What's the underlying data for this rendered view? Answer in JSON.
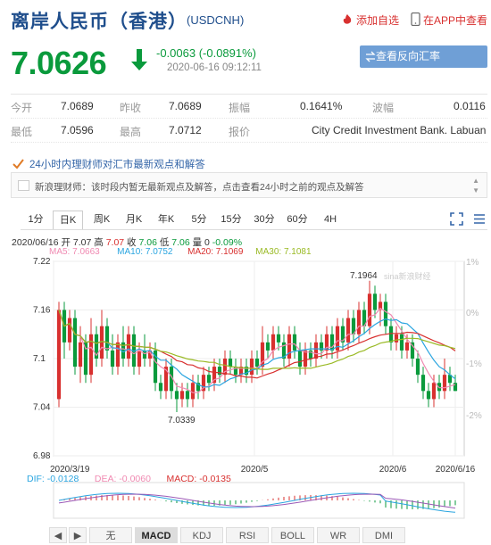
{
  "header": {
    "title": "离岸人民币（香港）",
    "code": "(USDCNH)",
    "add_watch": "添加自选",
    "view_app": "在APP中查看"
  },
  "quote": {
    "price": "7.0626",
    "change": "-0.0063 (-0.0891%)",
    "time": "2020-06-16 09:12:11",
    "reverse_button": "查看反向汇率 CNHUSD",
    "color_down": "#0a9a3c"
  },
  "stats": {
    "open_label": "今开",
    "open": "7.0689",
    "prev_label": "昨收",
    "prev": "7.0689",
    "amp_label": "振幅",
    "amp": "0.1641%",
    "wave_label": "波幅",
    "wave": "0.0116",
    "low_label": "最低",
    "low": "7.0596",
    "high_label": "最高",
    "high": "7.0712",
    "quote_label": "报价",
    "quote_src": "City Credit Investment Bank. Labuan"
  },
  "news": {
    "title": "24小时内理财师对汇市最新观点和解答",
    "text": "新浪理财师：该时段内暂无最新观点及解答，点击查看24小时之前的观点及解答"
  },
  "tabs": [
    "1分",
    "日K",
    "周K",
    "月K",
    "年K",
    "5分",
    "15分",
    "30分",
    "60分",
    "4H"
  ],
  "active_tab": "日K",
  "info": {
    "line1_date": "2020/06/16",
    "line1_open_label": "开",
    "line1_open": "7.07",
    "line1_high_label": "高",
    "line1_high": "7.07",
    "line1_close_label": "收",
    "line1_close": "7.06",
    "line1_low_label": "低",
    "line1_low": "7.06",
    "line1_vol_label": "量",
    "line1_vol": "0",
    "line1_chg": "-0.09%",
    "ma5": "MA5: 7.0663",
    "ma10": "MA10: 7.0752",
    "ma20": "MA20: 7.1069",
    "ma30": "MA30: 7.1081"
  },
  "colors": {
    "up": "#d8302f",
    "down": "#0a9a3c",
    "ma5": "#f08ab2",
    "ma10": "#2aa5e0",
    "ma20": "#d8302f",
    "ma30": "#9aba25"
  },
  "chart_data": {
    "type": "candlestick",
    "y_ticks": [
      "7.22",
      "7.16",
      "7.1",
      "7.04",
      "6.98"
    ],
    "pct_ticks": [
      "1%",
      "0%",
      "-1%",
      "-2%"
    ],
    "x_ticks": [
      "2020/3/19",
      "2020/5",
      "2020/6",
      "2020/6/16"
    ],
    "high_label": "7.1964",
    "low_label": "7.0339",
    "watermark": "sina新浪财经",
    "ylim": [
      6.98,
      7.22
    ],
    "candles": [
      [
        7.05,
        7.16,
        7.17,
        7.04
      ],
      [
        7.16,
        7.12,
        7.17,
        7.1
      ],
      [
        7.12,
        7.15,
        7.16,
        7.11
      ],
      [
        7.15,
        7.09,
        7.16,
        7.08
      ],
      [
        7.09,
        7.12,
        7.14,
        7.07
      ],
      [
        7.12,
        7.08,
        7.13,
        7.07
      ],
      [
        7.08,
        7.13,
        7.15,
        7.07
      ],
      [
        7.13,
        7.1,
        7.14,
        7.09
      ],
      [
        7.1,
        7.14,
        7.16,
        7.09
      ],
      [
        7.14,
        7.11,
        7.15,
        7.1
      ],
      [
        7.11,
        7.09,
        7.13,
        7.08
      ],
      [
        7.09,
        7.12,
        7.13,
        7.08
      ],
      [
        7.12,
        7.1,
        7.14,
        7.09
      ],
      [
        7.1,
        7.13,
        7.14,
        7.09
      ],
      [
        7.13,
        7.09,
        7.14,
        7.08
      ],
      [
        7.09,
        7.11,
        7.12,
        7.08
      ],
      [
        7.11,
        7.1,
        7.13,
        7.09
      ],
      [
        7.1,
        7.11,
        7.12,
        7.09
      ],
      [
        7.11,
        7.07,
        7.12,
        7.06
      ],
      [
        7.07,
        7.06,
        7.08,
        7.05
      ],
      [
        7.06,
        7.09,
        7.1,
        7.05
      ],
      [
        7.09,
        7.06,
        7.1,
        7.05
      ],
      [
        7.06,
        7.05,
        7.07,
        7.034
      ],
      [
        7.05,
        7.06,
        7.07,
        7.04
      ],
      [
        7.06,
        7.05,
        7.07,
        7.04
      ],
      [
        7.05,
        7.07,
        7.08,
        7.04
      ],
      [
        7.07,
        7.06,
        7.08,
        7.05
      ],
      [
        7.06,
        7.08,
        7.09,
        7.05
      ],
      [
        7.08,
        7.07,
        7.09,
        7.06
      ],
      [
        7.07,
        7.09,
        7.1,
        7.06
      ],
      [
        7.09,
        7.08,
        7.1,
        7.07
      ],
      [
        7.08,
        7.1,
        7.11,
        7.07
      ],
      [
        7.1,
        7.09,
        7.11,
        7.08
      ],
      [
        7.09,
        7.08,
        7.1,
        7.07
      ],
      [
        7.08,
        7.09,
        7.1,
        7.07
      ],
      [
        7.09,
        7.08,
        7.1,
        7.07
      ],
      [
        7.08,
        7.1,
        7.11,
        7.07
      ],
      [
        7.1,
        7.09,
        7.11,
        7.08
      ],
      [
        7.09,
        7.12,
        7.14,
        7.08
      ],
      [
        7.12,
        7.11,
        7.13,
        7.1
      ],
      [
        7.11,
        7.13,
        7.14,
        7.1
      ],
      [
        7.13,
        7.12,
        7.14,
        7.11
      ],
      [
        7.12,
        7.1,
        7.13,
        7.09
      ],
      [
        7.1,
        7.13,
        7.14,
        7.09
      ],
      [
        7.13,
        7.11,
        7.14,
        7.1
      ],
      [
        7.11,
        7.09,
        7.12,
        7.08
      ],
      [
        7.09,
        7.11,
        7.12,
        7.08
      ],
      [
        7.11,
        7.1,
        7.12,
        7.09
      ],
      [
        7.1,
        7.12,
        7.13,
        7.09
      ],
      [
        7.12,
        7.11,
        7.13,
        7.1
      ],
      [
        7.11,
        7.13,
        7.14,
        7.1
      ],
      [
        7.13,
        7.11,
        7.14,
        7.1
      ],
      [
        7.11,
        7.14,
        7.15,
        7.1
      ],
      [
        7.14,
        7.12,
        7.15,
        7.11
      ],
      [
        7.12,
        7.15,
        7.16,
        7.11
      ],
      [
        7.15,
        7.13,
        7.16,
        7.12
      ],
      [
        7.13,
        7.16,
        7.17,
        7.12
      ],
      [
        7.16,
        7.14,
        7.17,
        7.13
      ],
      [
        7.14,
        7.18,
        7.196,
        7.13
      ],
      [
        7.18,
        7.16,
        7.19,
        7.15
      ],
      [
        7.16,
        7.17,
        7.18,
        7.14
      ],
      [
        7.17,
        7.14,
        7.18,
        7.13
      ],
      [
        7.14,
        7.12,
        7.15,
        7.11
      ],
      [
        7.12,
        7.13,
        7.14,
        7.11
      ],
      [
        7.13,
        7.11,
        7.14,
        7.1
      ],
      [
        7.11,
        7.12,
        7.13,
        7.1
      ],
      [
        7.12,
        7.1,
        7.13,
        7.09
      ],
      [
        7.1,
        7.08,
        7.11,
        7.07
      ],
      [
        7.08,
        7.06,
        7.09,
        7.05
      ],
      [
        7.06,
        7.05,
        7.07,
        7.04
      ],
      [
        7.05,
        7.07,
        7.08,
        7.04
      ],
      [
        7.07,
        7.06,
        7.08,
        7.05
      ],
      [
        7.06,
        7.08,
        7.1,
        7.05
      ],
      [
        7.08,
        7.07,
        7.09,
        7.06
      ],
      [
        7.07,
        7.06,
        7.08,
        7.06
      ]
    ],
    "macd": {
      "dif": "DIF: -0.0128",
      "dea": "DEA: -0.0060",
      "macd": "MACD: -0.0135"
    }
  },
  "bottom_tabs": [
    "无",
    "MACD",
    "KDJ",
    "RSI",
    "BOLL",
    "WR",
    "DMI"
  ],
  "bottom_active": "MACD"
}
